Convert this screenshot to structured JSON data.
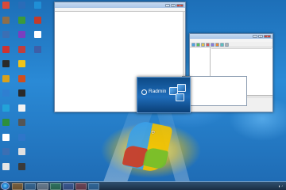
{
  "desktop": {
    "icons": [
      {
        "label": "",
        "color": "#d94a3a"
      },
      {
        "label": "",
        "color": "#8d6e4a"
      },
      {
        "label": "",
        "color": "#3b6fb4"
      },
      {
        "label": "",
        "color": "#cc3333"
      },
      {
        "label": "",
        "color": "#2a2a2a"
      },
      {
        "label": "",
        "color": "#d7a11c"
      },
      {
        "label": "",
        "color": "#2f7fd1"
      },
      {
        "label": "",
        "color": "#22a3d9"
      },
      {
        "label": "",
        "color": "#2d8f3c"
      },
      {
        "label": "",
        "color": "#ffffff"
      },
      {
        "label": "",
        "color": "#3b6fb4"
      },
      {
        "label": "",
        "color": "#e5e5e5"
      },
      {
        "label": "",
        "color": "#2a6cb8"
      },
      {
        "label": "",
        "color": "#3b9a3b"
      },
      {
        "label": "",
        "color": "#7a3fbf"
      },
      {
        "label": "",
        "color": "#bf3f3f"
      },
      {
        "label": "",
        "color": "#f0c419"
      },
      {
        "label": "",
        "color": "#d04f1f"
      },
      {
        "label": "",
        "color": "#2a2a2a"
      },
      {
        "label": "",
        "color": "#f2f2f2"
      },
      {
        "label": "",
        "color": "#555555"
      },
      {
        "label": "",
        "color": "#2e76c9"
      },
      {
        "label": "",
        "color": "#e0e0e0"
      },
      {
        "label": "",
        "color": "#3a3a3a"
      },
      {
        "label": "",
        "color": "#1f8fd6"
      },
      {
        "label": "",
        "color": "#c23b2b"
      },
      {
        "label": "",
        "color": "#ffffff"
      },
      {
        "label": "",
        "color": "#3d5fa8"
      }
    ]
  },
  "notepad": {
    "title": "",
    "menu": [
      "",
      "",
      "",
      "",
      ""
    ],
    "lines": [
      "",
      "",
      "",
      "",
      "",
      "",
      "",
      "",
      "",
      "",
      "",
      "",
      "",
      "",
      "",
      "",
      "",
      ""
    ]
  },
  "splash": {
    "brand": "Radmin",
    "tagline": "",
    "version": ""
  },
  "radmin": {
    "title": "",
    "menu": [
      "",
      "",
      "",
      "",
      ""
    ],
    "tree": [
      ""
    ],
    "list_header": {
      "name": "",
      "ip": "",
      "status": ""
    },
    "list": [
      {
        "name": "",
        "ip": "",
        "status": ""
      },
      {
        "name": "",
        "ip": "",
        "status": ""
      },
      {
        "name": "",
        "ip": "",
        "status": ""
      },
      {
        "name": "",
        "ip": "",
        "status": ""
      },
      {
        "name": "",
        "ip": "",
        "status": ""
      }
    ],
    "status": ""
  },
  "table_panel": {
    "header": [
      "",
      "",
      "",
      "",
      ""
    ],
    "rows": [
      [
        "",
        "",
        "",
        "",
        ""
      ],
      [
        "",
        "",
        "",
        "",
        ""
      ],
      [
        "",
        "",
        "",
        "",
        ""
      ],
      [
        "",
        "",
        "",
        "",
        ""
      ],
      [
        "",
        "",
        "",
        "",
        ""
      ],
      [
        "",
        "",
        "",
        "",
        ""
      ],
      [
        "",
        "",
        "",
        "",
        ""
      ],
      [
        "",
        "",
        "",
        "",
        ""
      ],
      [
        "",
        "",
        "",
        "",
        ""
      ],
      [
        "",
        "",
        "",
        "",
        ""
      ]
    ]
  },
  "taskbar": {
    "language": "",
    "time": "",
    "date": ""
  }
}
